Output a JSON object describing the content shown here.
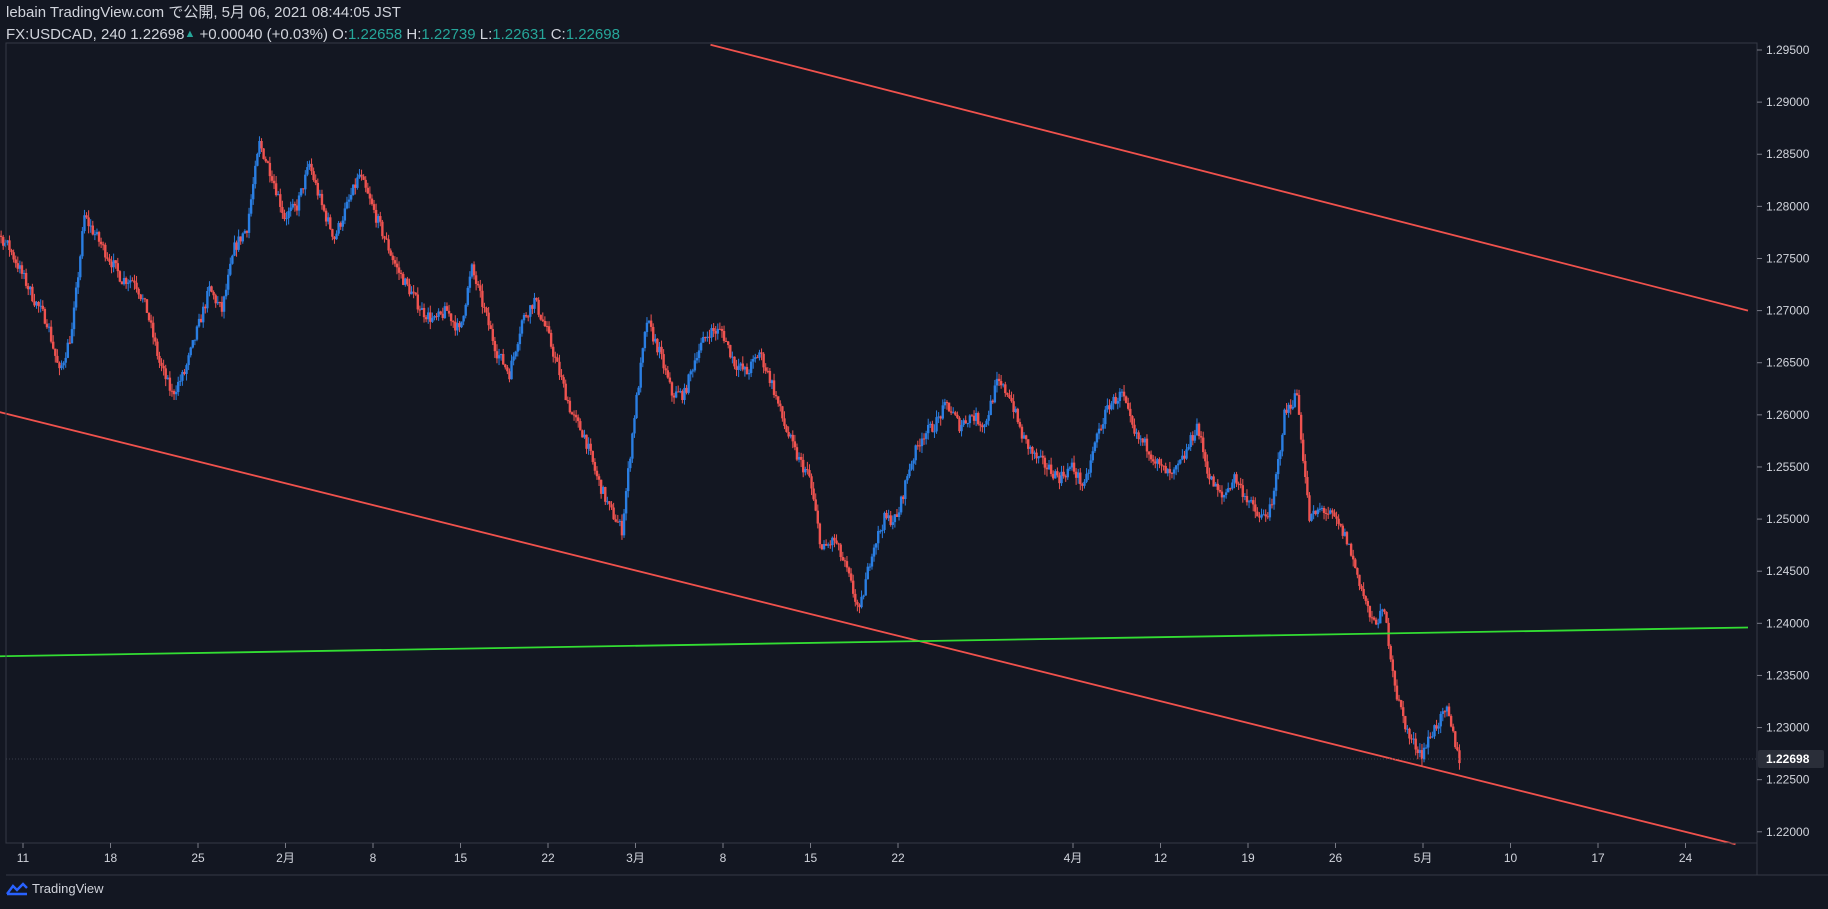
{
  "header": {
    "line1": "lebain TradingView.com で公開, 5月 06, 2021 08:44:05 JST",
    "symbol": "FX:USDCAD, 240",
    "last": "1.22698",
    "change": "+0.00040 (+0.03%)",
    "o_label": "O:",
    "o": "1.22658",
    "h_label": "H:",
    "h": "1.22739",
    "l_label": "L:",
    "l": "1.22631",
    "c_label": "C:",
    "c": "1.22698"
  },
  "footer": {
    "brand": "TradingView",
    "icon": "tradingview-logo-icon"
  },
  "colors": {
    "background": "#131722",
    "up": "#2a7ee2",
    "down": "#ef5350",
    "trendline": "#f0524d",
    "support": "#33dd33",
    "axis_text": "#d1d4dc",
    "price_tag_bg": "#2a2e39"
  },
  "chart_data": {
    "type": "candlestick",
    "symbol": "FX:USDCAD",
    "interval": "240",
    "y_ticks": [
      "1.29500",
      "1.29000",
      "1.28500",
      "1.28000",
      "1.27500",
      "1.27000",
      "1.26500",
      "1.26000",
      "1.25500",
      "1.25000",
      "1.24500",
      "1.24000",
      "1.23500",
      "1.23000",
      "1.22500",
      "1.22000"
    ],
    "y_range": [
      1.219,
      1.2955
    ],
    "x_ticks": [
      "11",
      "18",
      "25",
      "2月",
      "8",
      "15",
      "22",
      "3月",
      "8",
      "15",
      "22",
      "4月",
      "12",
      "19",
      "26",
      "5月",
      "10",
      "17",
      "24"
    ],
    "x_tick_dates": [
      "2021-01-11",
      "2021-01-18",
      "2021-01-25",
      "2021-02-01",
      "2021-02-08",
      "2021-02-15",
      "2021-02-22",
      "2021-03-01",
      "2021-03-08",
      "2021-03-15",
      "2021-03-22",
      "2021-04-05",
      "2021-04-12",
      "2021-04-19",
      "2021-04-26",
      "2021-05-03",
      "2021-05-10",
      "2021-05-17",
      "2021-05-24"
    ],
    "last_price": "1.22698",
    "close_series": [
      {
        "date": "2021-01-07",
        "close": 1.269
      },
      {
        "date": "2021-01-08",
        "close": 1.279
      },
      {
        "date": "2021-01-10",
        "close": 1.276
      },
      {
        "date": "2021-01-12",
        "close": 1.271
      },
      {
        "date": "2021-01-13",
        "close": 1.269
      },
      {
        "date": "2021-01-14",
        "close": 1.264
      },
      {
        "date": "2021-01-15",
        "close": 1.268
      },
      {
        "date": "2021-01-16",
        "close": 1.279
      },
      {
        "date": "2021-01-18",
        "close": 1.275
      },
      {
        "date": "2021-01-19",
        "close": 1.273
      },
      {
        "date": "2021-01-20",
        "close": 1.273
      },
      {
        "date": "2021-01-21",
        "close": 1.27
      },
      {
        "date": "2021-01-22",
        "close": 1.265
      },
      {
        "date": "2021-01-23",
        "close": 1.262
      },
      {
        "date": "2021-01-24",
        "close": 1.264
      },
      {
        "date": "2021-01-25",
        "close": 1.268
      },
      {
        "date": "2021-01-26",
        "close": 1.272
      },
      {
        "date": "2021-01-27",
        "close": 1.27
      },
      {
        "date": "2021-01-28",
        "close": 1.276
      },
      {
        "date": "2021-01-29",
        "close": 1.278
      },
      {
        "date": "2021-01-30",
        "close": 1.286
      },
      {
        "date": "2021-01-31",
        "close": 1.283
      },
      {
        "date": "2021-02-01",
        "close": 1.279
      },
      {
        "date": "2021-02-02",
        "close": 1.28
      },
      {
        "date": "2021-02-03",
        "close": 1.284
      },
      {
        "date": "2021-02-04",
        "close": 1.28
      },
      {
        "date": "2021-02-05",
        "close": 1.277
      },
      {
        "date": "2021-02-06",
        "close": 1.28
      },
      {
        "date": "2021-02-07",
        "close": 1.283
      },
      {
        "date": "2021-02-08",
        "close": 1.28
      },
      {
        "date": "2021-02-09",
        "close": 1.277
      },
      {
        "date": "2021-02-10",
        "close": 1.274
      },
      {
        "date": "2021-02-11",
        "close": 1.272
      },
      {
        "date": "2021-02-12",
        "close": 1.27
      },
      {
        "date": "2021-02-13",
        "close": 1.269
      },
      {
        "date": "2021-02-14",
        "close": 1.27
      },
      {
        "date": "2021-02-15",
        "close": 1.268
      },
      {
        "date": "2021-02-16",
        "close": 1.274
      },
      {
        "date": "2021-02-17",
        "close": 1.27
      },
      {
        "date": "2021-02-18",
        "close": 1.266
      },
      {
        "date": "2021-02-19",
        "close": 1.264
      },
      {
        "date": "2021-02-20",
        "close": 1.269
      },
      {
        "date": "2021-02-21",
        "close": 1.271
      },
      {
        "date": "2021-02-22",
        "close": 1.268
      },
      {
        "date": "2021-02-23",
        "close": 1.264
      },
      {
        "date": "2021-02-24",
        "close": 1.26
      },
      {
        "date": "2021-02-25",
        "close": 1.258
      },
      {
        "date": "2021-02-26",
        "close": 1.254
      },
      {
        "date": "2021-02-27",
        "close": 1.251
      },
      {
        "date": "2021-02-28",
        "close": 1.249
      },
      {
        "date": "2021-03-01",
        "close": 1.26
      },
      {
        "date": "2021-03-02",
        "close": 1.269
      },
      {
        "date": "2021-03-03",
        "close": 1.266
      },
      {
        "date": "2021-03-04",
        "close": 1.262
      },
      {
        "date": "2021-03-05",
        "close": 1.262
      },
      {
        "date": "2021-03-06",
        "close": 1.266
      },
      {
        "date": "2021-03-07",
        "close": 1.268
      },
      {
        "date": "2021-03-08",
        "close": 1.268
      },
      {
        "date": "2021-03-09",
        "close": 1.265
      },
      {
        "date": "2021-03-10",
        "close": 1.264
      },
      {
        "date": "2021-03-11",
        "close": 1.266
      },
      {
        "date": "2021-03-12",
        "close": 1.263
      },
      {
        "date": "2021-03-13",
        "close": 1.259
      },
      {
        "date": "2021-03-14",
        "close": 1.256
      },
      {
        "date": "2021-03-15",
        "close": 1.254
      },
      {
        "date": "2021-03-16",
        "close": 1.247
      },
      {
        "date": "2021-03-17",
        "close": 1.248
      },
      {
        "date": "2021-03-18",
        "close": 1.245
      },
      {
        "date": "2021-03-19",
        "close": 1.241
      },
      {
        "date": "2021-03-20",
        "close": 1.247
      },
      {
        "date": "2021-03-21",
        "close": 1.25
      },
      {
        "date": "2021-03-22",
        "close": 1.25
      },
      {
        "date": "2021-03-23",
        "close": 1.255
      },
      {
        "date": "2021-03-24",
        "close": 1.258
      },
      {
        "date": "2021-03-25",
        "close": 1.259
      },
      {
        "date": "2021-03-26",
        "close": 1.261
      },
      {
        "date": "2021-03-27",
        "close": 1.259
      },
      {
        "date": "2021-03-28",
        "close": 1.26
      },
      {
        "date": "2021-03-29",
        "close": 1.259
      },
      {
        "date": "2021-03-30",
        "close": 1.263
      },
      {
        "date": "2021-03-31",
        "close": 1.262
      },
      {
        "date": "2021-04-01",
        "close": 1.258
      },
      {
        "date": "2021-04-02",
        "close": 1.256
      },
      {
        "date": "2021-04-03",
        "close": 1.255
      },
      {
        "date": "2021-04-04",
        "close": 1.254
      },
      {
        "date": "2021-04-05",
        "close": 1.255
      },
      {
        "date": "2021-04-06",
        "close": 1.253
      },
      {
        "date": "2021-04-07",
        "close": 1.258
      },
      {
        "date": "2021-04-08",
        "close": 1.261
      },
      {
        "date": "2021-04-09",
        "close": 1.262
      },
      {
        "date": "2021-04-10",
        "close": 1.258
      },
      {
        "date": "2021-04-11",
        "close": 1.257
      },
      {
        "date": "2021-04-12",
        "close": 1.255
      },
      {
        "date": "2021-04-13",
        "close": 1.254
      },
      {
        "date": "2021-04-14",
        "close": 1.256
      },
      {
        "date": "2021-04-15",
        "close": 1.259
      },
      {
        "date": "2021-04-16",
        "close": 1.254
      },
      {
        "date": "2021-04-17",
        "close": 1.252
      },
      {
        "date": "2021-04-18",
        "close": 1.254
      },
      {
        "date": "2021-04-19",
        "close": 1.252
      },
      {
        "date": "2021-04-20",
        "close": 1.25
      },
      {
        "date": "2021-04-21",
        "close": 1.251
      },
      {
        "date": "2021-04-22",
        "close": 1.26
      },
      {
        "date": "2021-04-23",
        "close": 1.262
      },
      {
        "date": "2021-04-24",
        "close": 1.25
      },
      {
        "date": "2021-04-25",
        "close": 1.251
      },
      {
        "date": "2021-04-26",
        "close": 1.25
      },
      {
        "date": "2021-04-27",
        "close": 1.248
      },
      {
        "date": "2021-04-28",
        "close": 1.244
      },
      {
        "date": "2021-04-29",
        "close": 1.24
      },
      {
        "date": "2021-04-30",
        "close": 1.241
      },
      {
        "date": "2021-05-01",
        "close": 1.233
      },
      {
        "date": "2021-05-02",
        "close": 1.229
      },
      {
        "date": "2021-05-03",
        "close": 1.2275
      },
      {
        "date": "2021-05-04",
        "close": 1.23
      },
      {
        "date": "2021-05-05",
        "close": 1.2315
      },
      {
        "date": "2021-05-06",
        "close": 1.227
      }
    ],
    "lines": [
      {
        "name": "upper-trendline",
        "color": "#f0524d",
        "from": {
          "date": "2021-03-07",
          "price": 1.2955
        },
        "to": {
          "date": "2021-05-29",
          "price": 1.27
        }
      },
      {
        "name": "lower-trendline",
        "color": "#f0524d",
        "from": {
          "date": "2021-01-07",
          "price": 1.2609
        },
        "to": {
          "date": "2021-05-28",
          "price": 1.2188
        }
      },
      {
        "name": "support-line",
        "color": "#33dd33",
        "from": {
          "date": "2021-01-07",
          "price": 1.2368
        },
        "to": {
          "date": "2021-05-29",
          "price": 1.2396
        }
      }
    ]
  }
}
